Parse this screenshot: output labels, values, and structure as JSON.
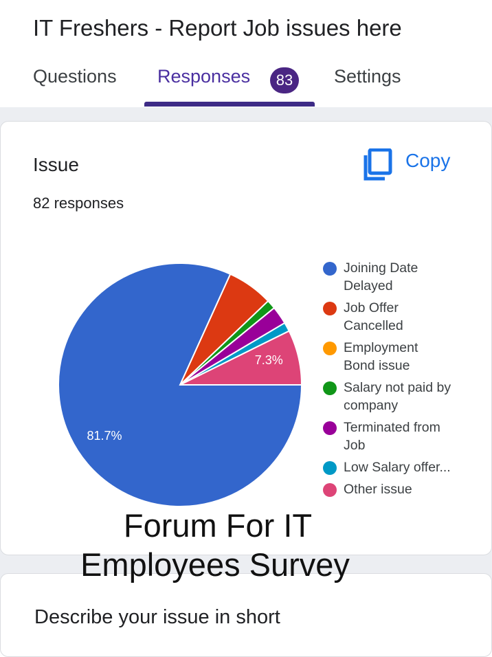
{
  "form": {
    "title": "IT Freshers - Report Job issues here"
  },
  "tabs": [
    {
      "label": "Questions"
    },
    {
      "label": "Responses",
      "badge": "83"
    },
    {
      "label": "Settings"
    }
  ],
  "question_card": {
    "title": "Issue",
    "responses_text": "82 responses",
    "copy_label": "Copy"
  },
  "chart_data": {
    "type": "pie",
    "categories": [
      "Joining Date Delayed",
      "Job Offer Cancelled",
      "Employment Bond issue",
      "Salary not paid by company",
      "Terminated from Job",
      "Low Salary offer...",
      "Other issue"
    ],
    "values": [
      81.7,
      6.1,
      0,
      1.2,
      2.4,
      1.2,
      7.3
    ],
    "value_unit": "%",
    "colors": [
      "#3366cc",
      "#dc3912",
      "#ff9900",
      "#109618",
      "#990099",
      "#0099c6",
      "#dd4477"
    ],
    "slice_labels": {
      "0": "81.7%",
      "6": "7.3%"
    },
    "legend": "right",
    "legend_lines": [
      [
        "Joining Date",
        "Delayed"
      ],
      [
        "Job Offer",
        "Cancelled"
      ],
      [
        "Employment",
        "Bond issue"
      ],
      [
        "Salary not paid by",
        "company"
      ],
      [
        "Terminated from",
        "Job"
      ],
      [
        "Low Salary offer..."
      ],
      [
        "Other issue"
      ]
    ]
  },
  "watermark": {
    "line1": "Forum For IT",
    "line2": "Employees Survey"
  },
  "next_question": {
    "title": "Describe your issue in short"
  },
  "icons": {
    "copy": "copy-icon"
  },
  "accent_colors": {
    "tab_active": "#4a2fa0",
    "badge_bg": "#4a2683",
    "copy_link": "#1a73e8"
  }
}
